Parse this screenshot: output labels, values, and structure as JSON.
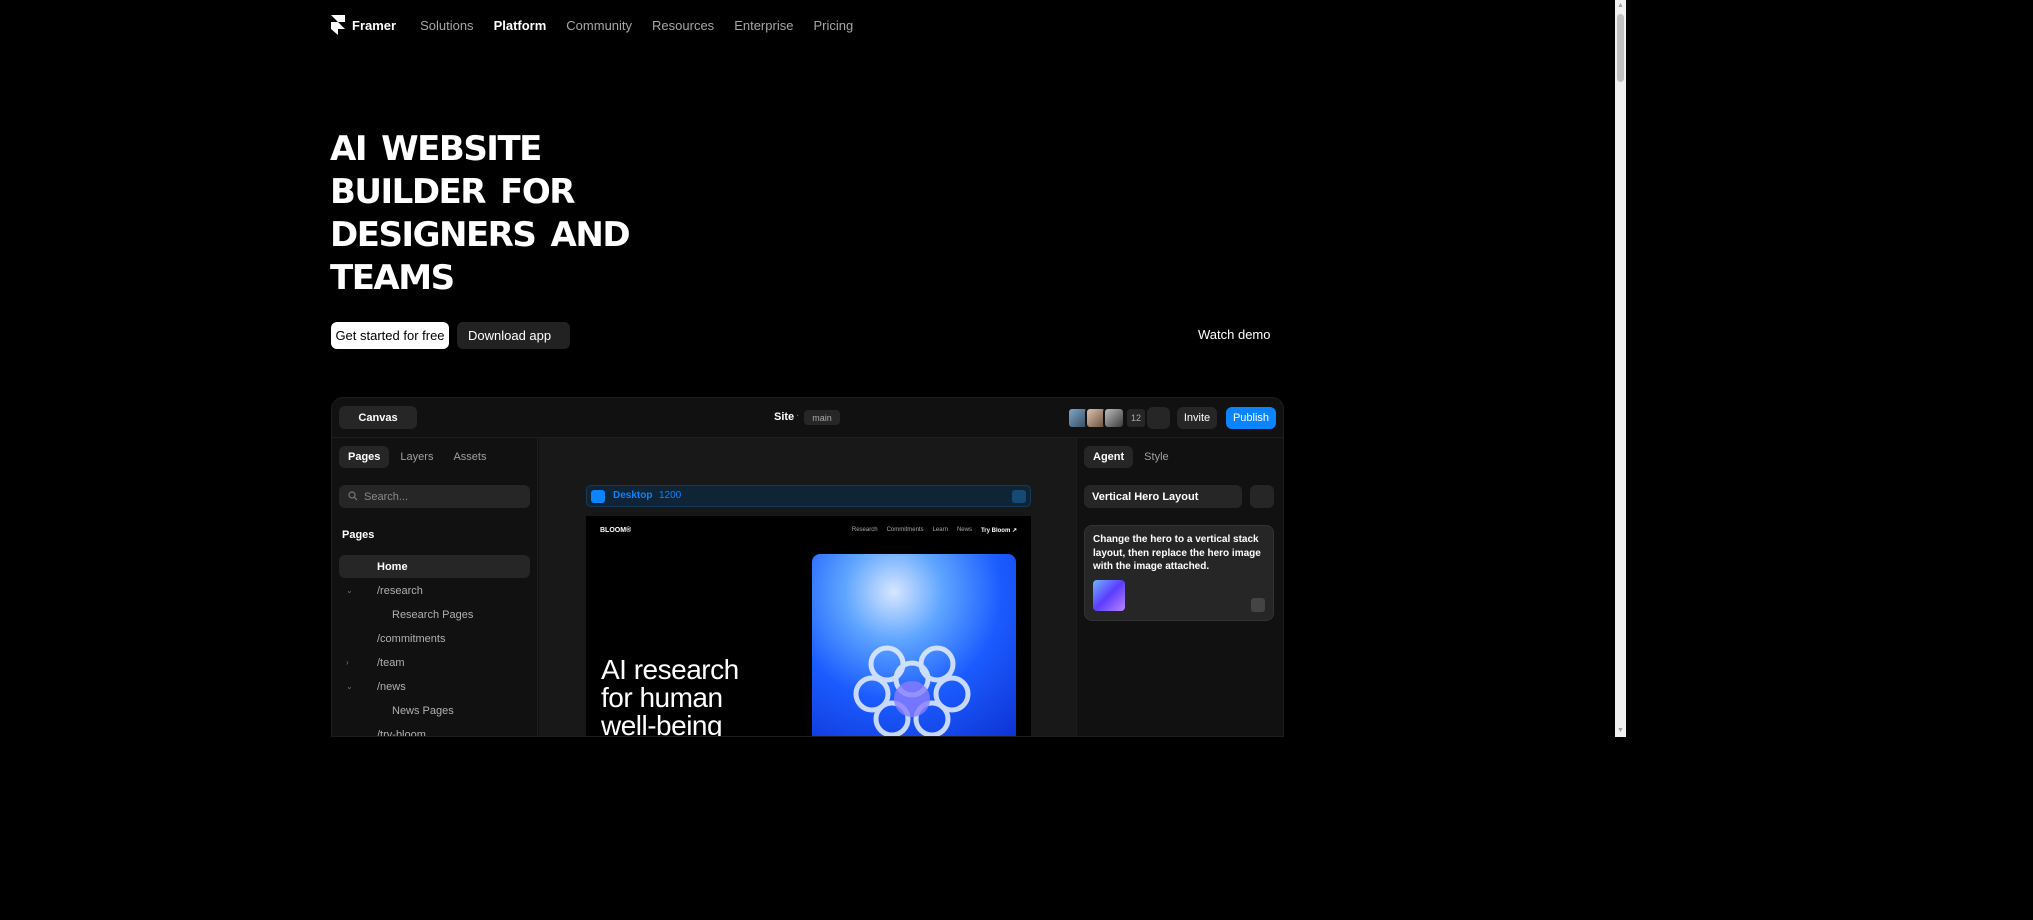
{
  "nav": {
    "brand": "Framer",
    "items": [
      {
        "label": "Solutions",
        "active": false
      },
      {
        "label": "Platform",
        "active": true
      },
      {
        "label": "Community",
        "active": false
      },
      {
        "label": "Resources",
        "active": false
      },
      {
        "label": "Enterprise",
        "active": false
      },
      {
        "label": "Pricing",
        "active": false
      }
    ]
  },
  "hero": {
    "title_lines": [
      "AI website",
      "builder for",
      "designers and",
      "teams"
    ],
    "primary_cta": "Get started for free",
    "secondary_cta": "Download app",
    "watch_demo": "Watch demo"
  },
  "editor": {
    "canvas_label": "Canvas",
    "site_label": "Site",
    "site_separator": "·",
    "branch": "main",
    "collaborator_count": "12",
    "invite_label": "Invite",
    "publish_label": "Publish",
    "left_tabs": [
      "Pages",
      "Layers",
      "Assets"
    ],
    "search_placeholder": "Search...",
    "pages_heading": "Pages",
    "pages": [
      {
        "label": "Home",
        "active": true,
        "chevron": "",
        "child": false
      },
      {
        "label": "/research",
        "active": false,
        "chevron": "⌄",
        "child": false
      },
      {
        "label": "Research Pages",
        "active": false,
        "chevron": "",
        "child": true
      },
      {
        "label": "/commitments",
        "active": false,
        "chevron": "",
        "child": false
      },
      {
        "label": "/team",
        "active": false,
        "chevron": "›",
        "child": false
      },
      {
        "label": "/news",
        "active": false,
        "chevron": "⌄",
        "child": false
      },
      {
        "label": "News Pages",
        "active": false,
        "chevron": "",
        "child": true
      },
      {
        "label": "/try-bloom",
        "active": false,
        "chevron": "",
        "child": false
      }
    ],
    "frame": {
      "label": "Desktop",
      "width": "1200"
    },
    "preview": {
      "logo": "BLOOM®",
      "nav": [
        "Research",
        "Commitments",
        "Learn",
        "News",
        "Try Bloom ↗"
      ],
      "heading_lines": [
        "AI research",
        "for human",
        "well-being"
      ]
    },
    "right_tabs": [
      "Agent",
      "Style"
    ],
    "layout_field": "Vertical Hero Layout",
    "prompt": "Change the hero to a vertical stack layout, then replace the hero image with the image attached."
  },
  "colors": {
    "background": "#000000",
    "accent": "#0a84ff",
    "panel": "#111111",
    "control": "#262626"
  }
}
